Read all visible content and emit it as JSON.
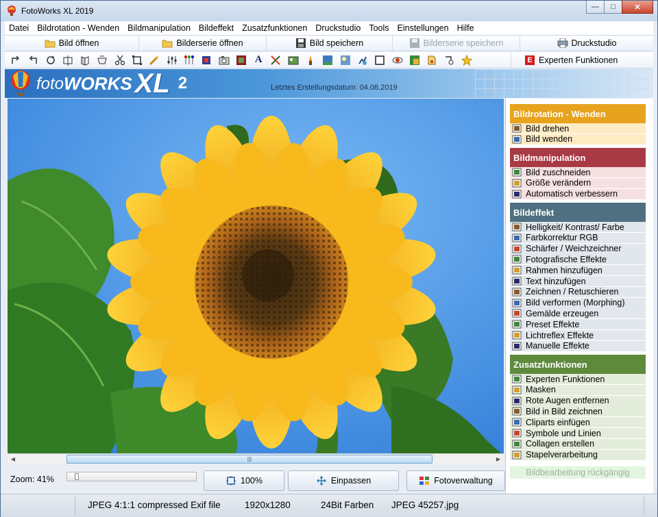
{
  "window": {
    "title": "FotoWorks XL 2019",
    "controls": {
      "minimize": "—",
      "maximize": "□",
      "close": "✕"
    }
  },
  "menu": [
    "Datei",
    "Bildrotation - Wenden",
    "Bildmanipulation",
    "Bildeffekt",
    "Zusatzfunktionen",
    "Druckstudio",
    "Tools",
    "Einstellungen",
    "Hilfe"
  ],
  "toolbar": {
    "open_image": "Bild öffnen",
    "open_series": "Bilderserie öffnen",
    "save_image": "Bild speichern",
    "save_series": "Bilderserie speichern",
    "print_studio": "Druckstudio"
  },
  "icon_toolbar": {
    "icons": [
      "rotate-left-icon",
      "rotate-right-icon",
      "rotate-icon",
      "flip-icon",
      "mirror-icon",
      "perspective-icon",
      "crop-scissors-icon",
      "resize-icon",
      "auto-enhance-icon",
      "brightness-icon",
      "color-rgb-icon",
      "sharpen-icon",
      "photo-effects-icon",
      "frame-icon",
      "text-icon",
      "draw-icon",
      "morph-icon",
      "painting-icon",
      "preset-icon",
      "lens-flare-icon",
      "manual-effects-icon",
      "mask-icon",
      "red-eye-icon",
      "picture-in-picture-icon",
      "clipart-icon",
      "symbols-icon",
      "collage-star-icon"
    ],
    "text_glyph": "A",
    "expert_badge": "E",
    "expert_label": "Experten Funktionen"
  },
  "banner": {
    "logo_part1": "foto",
    "logo_part2": "WORKS",
    "logo_part3": "XL",
    "logo_version": "2",
    "date_text": "Letztes Erstellungsdatum: 04.08.2019"
  },
  "sidebar": {
    "sections": [
      {
        "title": "Bildrotation - Wenden",
        "color": "#e7a31d",
        "item_bg": "#fdebc4",
        "items": [
          "Bild drehen",
          "Bild wenden"
        ]
      },
      {
        "title": "Bildmanipulation",
        "color": "#a83a45",
        "item_bg": "#f4dfe1",
        "items": [
          "Bild zuschneiden",
          "Größe verändern",
          "Automatisch verbessern"
        ]
      },
      {
        "title": "Bildeffekt",
        "color": "#4f7080",
        "item_bg": "#e1e7ec",
        "items": [
          "Helligkeit/ Kontrast/ Farbe",
          "Farbkorrektur RGB",
          "Schärfer / Weichzeichner",
          "Fotografische Effekte",
          "Rahmen hinzufügen",
          "Text hinzufügen",
          "Zeichnen / Retuschieren",
          "Bild verformen (Morphing)",
          "Gemälde erzeugen",
          "Preset Effekte",
          "Lichtreflex Effekte",
          "Manuelle Effekte"
        ]
      },
      {
        "title": "Zusatzfunktionen",
        "color": "#5e8a3c",
        "item_bg": "#e4eddc",
        "items": [
          "Experten Funktionen",
          "Masken",
          "Rote Augen entfernen",
          "Bild in Bild zeichnen",
          "Cliparts einfügen",
          "Symbole und Linien",
          "Collagen erstellen",
          "Stapelverarbeitung"
        ]
      }
    ],
    "undo_label": "Bildbearbeitung rückgängig"
  },
  "bottom": {
    "zoom_label": "Zoom: 41%",
    "zoom_fraction": 0.05,
    "btn_100": "100%",
    "btn_fit": "Einpassen",
    "btn_manager": "Fotoverwaltung"
  },
  "scrollbar": {
    "grip": "|||",
    "left_arrow": "◀",
    "right_arrow": "▶"
  },
  "status": {
    "format": "JPEG 4:1:1 compressed Exif file",
    "resolution": "1920x1280",
    "depth": "24Bit Farben",
    "filename": "JPEG 45257.jpg"
  }
}
